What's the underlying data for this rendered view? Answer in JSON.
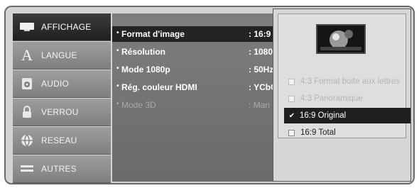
{
  "sidebar": {
    "items": [
      {
        "label": "AFFICHAGE",
        "icon": "display-icon",
        "active": true
      },
      {
        "label": "LANGUE",
        "icon": "language-icon",
        "active": false
      },
      {
        "label": "AUDIO",
        "icon": "audio-icon",
        "active": false
      },
      {
        "label": "VERROU",
        "icon": "lock-icon",
        "active": false
      },
      {
        "label": "RESEAU",
        "icon": "network-icon",
        "active": false
      },
      {
        "label": "AUTRES",
        "icon": "others-icon",
        "active": false
      }
    ]
  },
  "settings": {
    "rows": [
      {
        "label": "Format d'image",
        "value": ": 16:9",
        "selected": true,
        "disabled": false
      },
      {
        "label": "Résolution",
        "value": ": 1080",
        "selected": false,
        "disabled": false
      },
      {
        "label": "Mode 1080p",
        "value": ": 50Hz",
        "selected": false,
        "disabled": false
      },
      {
        "label": "Rég. couleur HDMI",
        "value": ": YCbC",
        "selected": false,
        "disabled": false
      },
      {
        "label": "Mode 3D",
        "value": ": Man",
        "selected": false,
        "disabled": true
      }
    ]
  },
  "popup": {
    "preview_icon": "aspect-ratio-preview-icon",
    "options": [
      {
        "label": "4:3 Format boite aux lettres",
        "state": "dim"
      },
      {
        "label": "4:3 Panoramique",
        "state": "dim"
      },
      {
        "label": "16:9 Original",
        "state": "selected"
      },
      {
        "label": "16:9 Total",
        "state": "normal"
      }
    ]
  },
  "colors": {
    "sidebar_active": "#232323",
    "sidebar_inactive": "#8e8e8e",
    "panel": "#747474",
    "popup": "#d6d6d6",
    "highlight": "#1f1f1f"
  }
}
